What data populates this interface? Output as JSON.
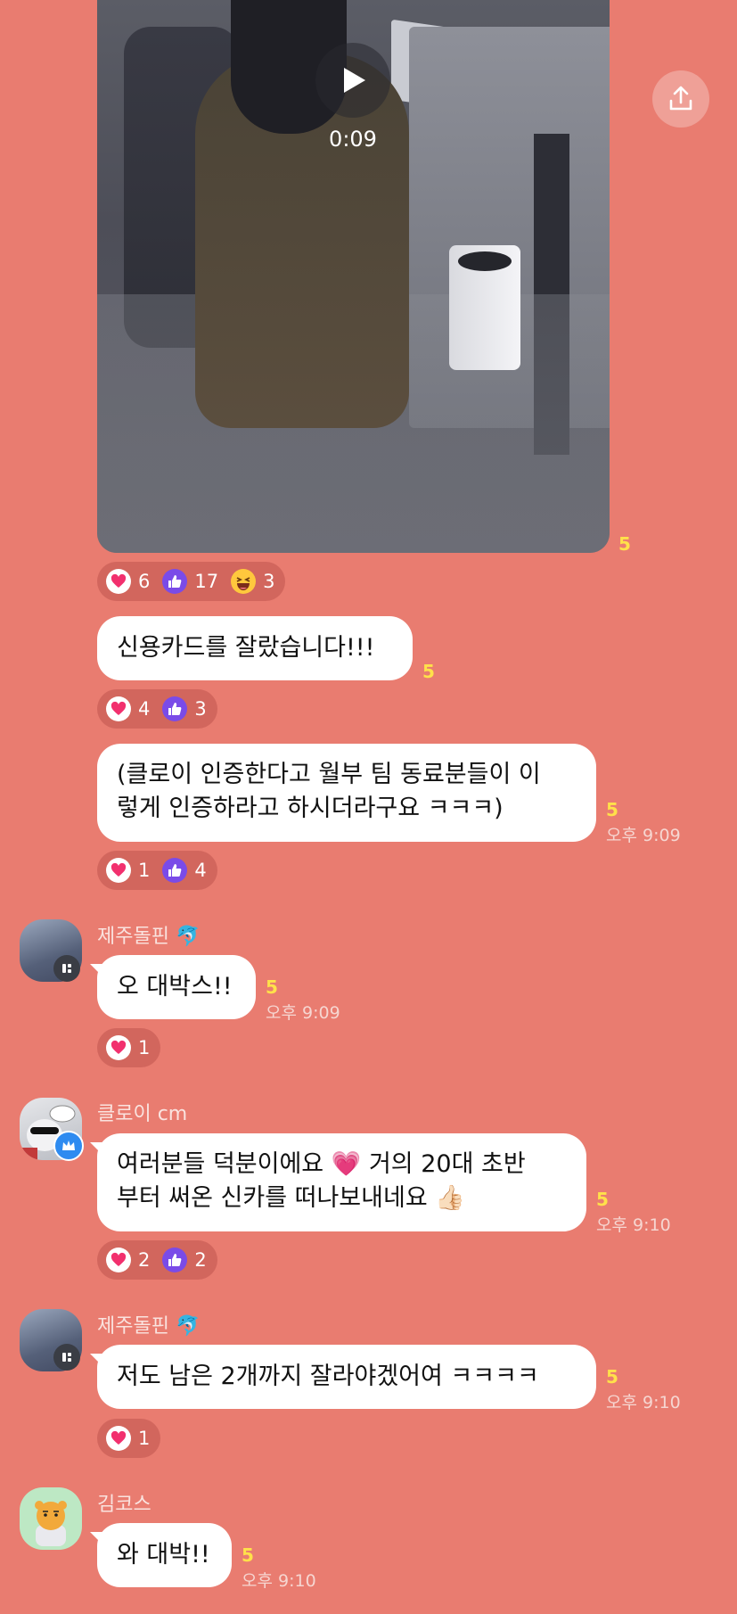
{
  "video": {
    "duration": "0:09",
    "unread": "5",
    "reactions": [
      {
        "icon": "heart-icon",
        "count": "6"
      },
      {
        "icon": "thumbs-up-icon",
        "count": "17"
      },
      {
        "icon": "grinning-squint-emoji",
        "count": "3"
      }
    ]
  },
  "messages": [
    {
      "text": "신용카드를 잘랐습니다!!!",
      "unread": "5",
      "reactions": [
        {
          "icon": "heart-icon",
          "count": "4"
        },
        {
          "icon": "thumbs-up-icon",
          "count": "3"
        }
      ]
    },
    {
      "lines": [
        "(클로이 인증한다고 월부 팀 동료분들이 이",
        "렇게 인증하라고 하시더라구요 ㅋㅋㅋ)"
      ],
      "unread": "5",
      "time": "오후 9:09",
      "reactions": [
        {
          "icon": "heart-icon",
          "count": "1"
        },
        {
          "icon": "thumbs-up-icon",
          "count": "4"
        }
      ]
    },
    {
      "sender": "제주돌핀",
      "sender_emoji": "🐬",
      "text": "오 대박스!!",
      "unread": "5",
      "time": "오후 9:09",
      "reactions": [
        {
          "icon": "heart-icon",
          "count": "1"
        }
      ]
    },
    {
      "sender": "클로이 cm",
      "line1_a": "여러분들 덕분이에요",
      "line1_emoji": "💗",
      "line1_b": "거의 20대 초반",
      "line2": "부터 써온 신카를 떠나보내네요",
      "line2_emoji": "👍🏻",
      "unread": "5",
      "time": "오후 9:10",
      "reactions": [
        {
          "icon": "heart-icon",
          "count": "2"
        },
        {
          "icon": "thumbs-up-icon",
          "count": "2"
        }
      ]
    },
    {
      "sender": "제주돌핀",
      "sender_emoji": "🐬",
      "text": "저도 남은 2개까지 잘라야겠어여 ㅋㅋㅋㅋ",
      "unread": "5",
      "time": "오후 9:10",
      "reactions": [
        {
          "icon": "heart-icon",
          "count": "1"
        }
      ]
    },
    {
      "sender": "김코스",
      "text": "와 대박!!",
      "unread": "5",
      "time": "오후 9:10"
    }
  ],
  "colors": {
    "background": "#E97C70",
    "reaction_pill": "#D2665D",
    "heart": "#F2306E",
    "thumb": "#7A4BE8",
    "unread": "#FFE14A"
  }
}
